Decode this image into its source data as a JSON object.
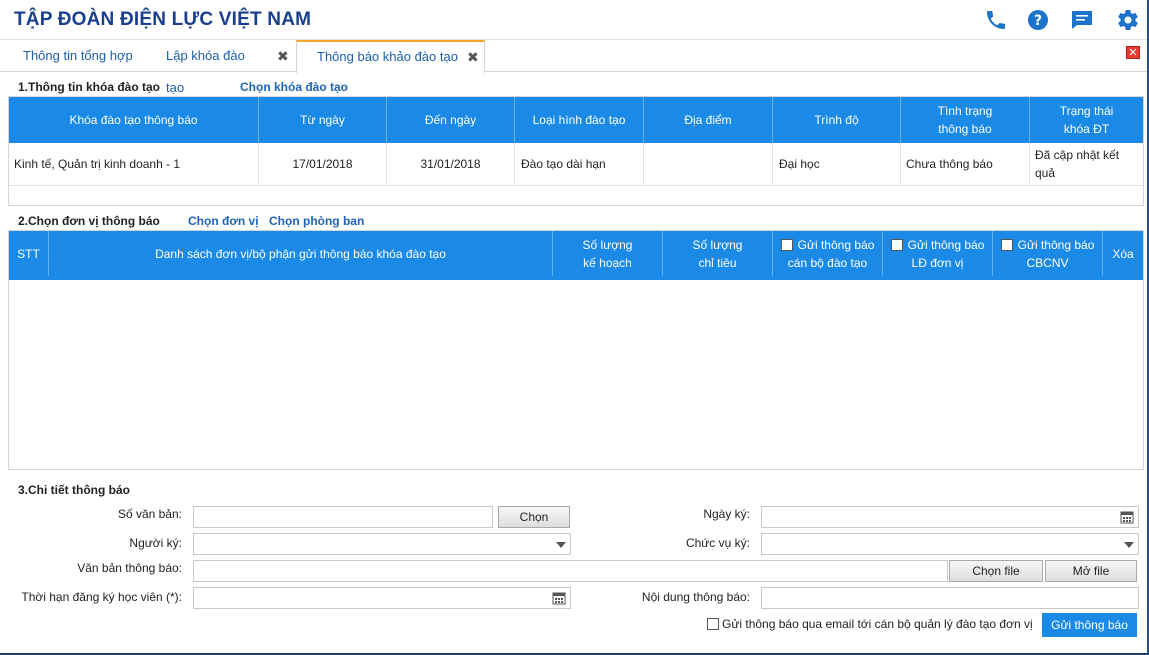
{
  "header": {
    "title": "TẬP ĐOÀN ĐIỆN LỰC VIỆT NAM",
    "icons": [
      "phone-icon",
      "help-icon",
      "chat-icon",
      "gear-icon"
    ],
    "accent": "#1b8ae6",
    "title_color": "#1b3f8f"
  },
  "tabs": [
    {
      "label": "Thông tin tổng hợp"
    },
    {
      "label": "Lập khóa đào tạo"
    },
    {
      "label": "Thông báo khảo đào tạo"
    }
  ],
  "section1": {
    "title": "1.Thông tin khóa đào tạo",
    "link": "Chọn khóa đào tạo",
    "columns": [
      "Khóa đào tạo thông báo",
      "Từ ngày",
      "Đến ngày",
      "Loại hình đào tạo",
      "Địa điểm",
      "Trình độ",
      "Tình trạng thông báo",
      "Trạng thái khóa ĐT"
    ],
    "rows": [
      [
        "Kinh tế, Quản trị kinh doanh - 1",
        "17/01/2018",
        "31/01/2018",
        "Đào tạo dài hạn",
        "",
        "Đại học",
        "Chưa thông báo",
        "Đã cập nhật kết quả"
      ]
    ]
  },
  "section2": {
    "title": "2.Chọn đơn vị thông báo",
    "link1": "Chọn đơn vị",
    "link2": "Chọn phòng ban",
    "col_stt": "STT",
    "col_list": "Danh sách đơn vị/bộ phận gửi thông báo khóa đào tạo",
    "col_plan_1": "Số lượng",
    "col_plan_2": "kế hoạch",
    "col_quota_1": "Số lượng",
    "col_quota_2": "chỉ tiêu",
    "col_send1_1": "Gửi thông báo",
    "col_send1_2": "cán bộ đào tạo",
    "col_send2_1": "Gửi thông báo",
    "col_send2_2": "LĐ đơn vị",
    "col_send3_1": "Gửi thông báo",
    "col_send3_2": "CBCNV",
    "col_delete": "Xóa"
  },
  "section3": {
    "title": "3.Chi tiết thông báo",
    "so_van_ban": "Số văn bản:",
    "chon": "Chọn",
    "ngay_ky": "Ngày ký:",
    "nguoi_ky": "Người ký:",
    "chuc_vu_ky": "Chức vụ ký:",
    "van_ban_thong_bao": "Văn bản thông báo:",
    "chon_file": "Chọn file",
    "mo_file": "Mở file",
    "thoi_han": "Thời hạn đăng ký học viên (*):",
    "noi_dung": "Nội dung thông báo:",
    "email_check": "Gửi thông báo qua email tới cán bộ quản lý đào tạo đơn vị",
    "send_button": "Gửi thông báo"
  }
}
